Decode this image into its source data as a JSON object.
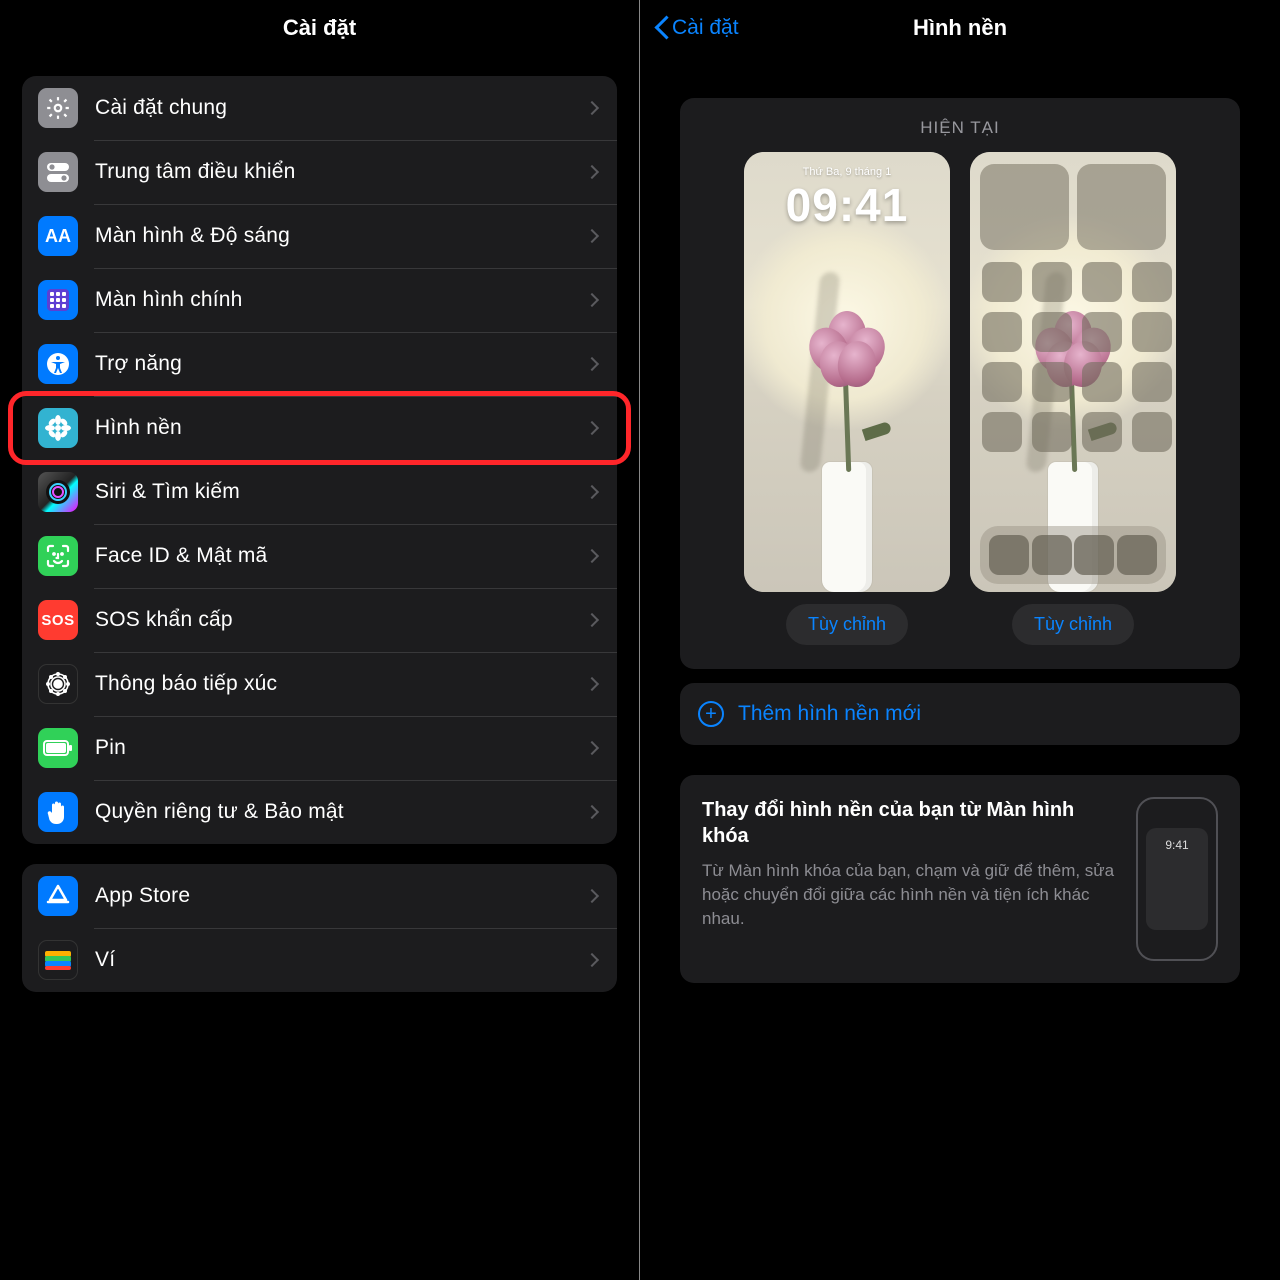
{
  "left": {
    "title": "Cài đặt",
    "rows": [
      {
        "label": "Cài đặt chung",
        "icon": "gear",
        "bg": "bg-gray"
      },
      {
        "label": "Trung tâm điều khiển",
        "icon": "toggles",
        "bg": "bg-gray"
      },
      {
        "label": "Màn hình & Độ sáng",
        "icon": "aa",
        "bg": "bg-blue"
      },
      {
        "label": "Màn hình chính",
        "icon": "grid",
        "bg": "bg-blue"
      },
      {
        "label": "Trợ năng",
        "icon": "access",
        "bg": "bg-blue"
      },
      {
        "label": "Hình nền",
        "icon": "flower",
        "bg": "bg-cyan",
        "highlight": true
      },
      {
        "label": "Siri & Tìm kiếm",
        "icon": "siri",
        "bg": "bg-grad"
      },
      {
        "label": "Face ID & Mật mã",
        "icon": "faceid",
        "bg": "bg-green"
      },
      {
        "label": "SOS khẩn cấp",
        "icon": "sos",
        "bg": "bg-red"
      },
      {
        "label": "Thông báo tiếp xúc",
        "icon": "exposure",
        "bg": "bg-black",
        "iconColor": "#ff3b30"
      },
      {
        "label": "Pin",
        "icon": "battery",
        "bg": "bg-green"
      },
      {
        "label": "Quyền riêng tư & Bảo mật",
        "icon": "hand",
        "bg": "bg-blue"
      }
    ],
    "rows2": [
      {
        "label": "App Store",
        "icon": "appstore",
        "bg": "bg-blue"
      },
      {
        "label": "Ví",
        "icon": "wallet",
        "bg": "bg-black"
      }
    ]
  },
  "right": {
    "back": "Cài đặt",
    "title": "Hình nền",
    "currentLabel": "HIỆN TẠI",
    "lockDate": "Thứ Ba, 9 tháng 1",
    "lockTime": "09:41",
    "customize": "Tùy chỉnh",
    "add": "Thêm hình nền mới",
    "info": {
      "title": "Thay đổi hình nền của bạn từ Màn hình khóa",
      "body": "Từ Màn hình khóa của bạn, chạm và giữ để thêm, sửa hoặc chuyển đổi giữa các hình nền và tiện ích khác nhau.",
      "miniTime": "9:41"
    }
  }
}
